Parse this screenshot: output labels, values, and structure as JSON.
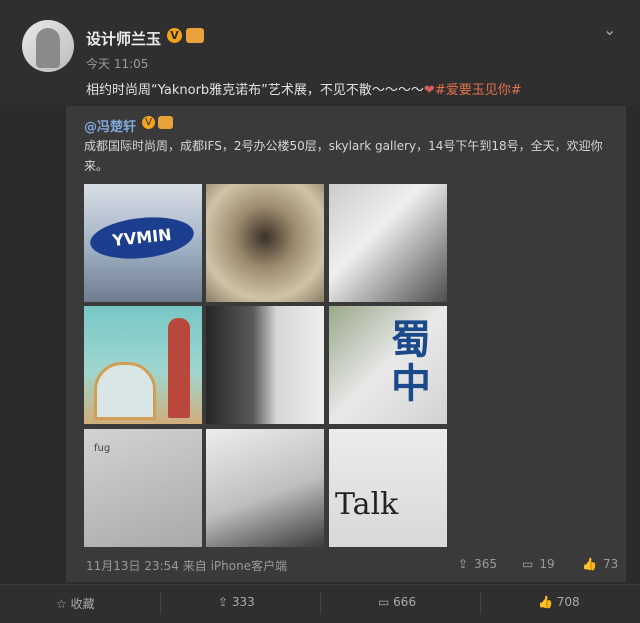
{
  "post": {
    "author": "设计师兰玉",
    "time": "今天 11:05",
    "text_main": "相约时尚周“Yaknorb雅克诺布”艺术展，不见不散～～～～",
    "text_topic": "#爱要玉见你#",
    "verified_label": "V",
    "retweet": {
      "author": "@冯楚轩",
      "verified_label": "V",
      "text": "成都国际时尚周，成都IFS，2号办公楼50层，skylark gallery，14号下午到18号，全天，欢迎你来。",
      "images": [
        {
          "icon": "building-sign-photo",
          "caption": "YVMIN"
        },
        {
          "icon": "straw-mask-photo"
        },
        {
          "icon": "masked-figure-photo"
        },
        {
          "icon": "exhibit-display-photo"
        },
        {
          "icon": "patterned-shirt-photo"
        },
        {
          "icon": "shu-zhong-poster-photo",
          "caption": "蜀中"
        },
        {
          "icon": "fug-book-photo",
          "caption": "fug"
        },
        {
          "icon": "book-portrait-photo"
        },
        {
          "icon": "talk-book-photo",
          "caption": "Talk"
        }
      ],
      "meta": "11月13日 23:54 来自 iPhone客户端",
      "stats": {
        "reposts": "365",
        "comments": "19",
        "likes": "73"
      }
    },
    "footer": {
      "favorite_label": "收藏",
      "reposts": "333",
      "comments": "666",
      "likes": "708"
    }
  },
  "colors": {
    "accent_link": "#7fa8d8",
    "topic": "#e2704a",
    "verified": "#f2a21b"
  }
}
